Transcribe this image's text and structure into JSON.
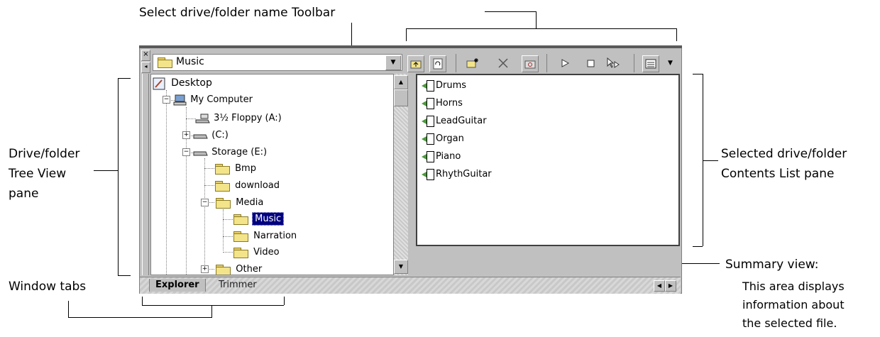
{
  "callouts": {
    "toolbar_select": "Select drive/folder name Toolbar",
    "tree_line1": "Drive/folder",
    "tree_line2": "Tree View",
    "tree_line3": "pane",
    "list_line1": "Selected drive/folder",
    "list_line2": "Contents List pane",
    "window_tabs": "Window tabs",
    "summary_title": "Summary view:",
    "summary_desc1": "This area displays",
    "summary_desc2": "information about",
    "summary_desc3": "the selected file."
  },
  "folder_select": {
    "value": "Music"
  },
  "tree": {
    "desktop": "Desktop",
    "my_computer": "My Computer",
    "floppy": "3½ Floppy (A:)",
    "c_drive": "(C:)",
    "storage": "Storage (E:)",
    "bmp": "Bmp",
    "download": "download",
    "media": "Media",
    "music": "Music",
    "narration": "Narration",
    "video": "Video",
    "other": "Other"
  },
  "files": [
    "Drums",
    "Horns",
    "LeadGuitar",
    "Organ",
    "Piano",
    "RhythGuitar"
  ],
  "tabs": {
    "explorer": "Explorer",
    "trimmer": "Trimmer"
  },
  "icons": [
    "close-icon",
    "pin-icon",
    "up-folder-icon",
    "refresh-icon",
    "new-folder-icon",
    "delete-icon",
    "properties-icon",
    "play-icon",
    "stop-icon",
    "play-selection-icon",
    "view-menu-icon",
    "dropdown-arrow-icon",
    "folder-icon",
    "audio-file-icon",
    "computer-icon",
    "floppy-icon",
    "drive-icon",
    "desktop-icon",
    "scroll-up-icon",
    "scroll-down-icon",
    "scroll-left-icon",
    "scroll-right-icon"
  ],
  "colors": {
    "selection": "#000080",
    "window_bg": "#c0c0c0",
    "folder": "#f3e48a"
  }
}
